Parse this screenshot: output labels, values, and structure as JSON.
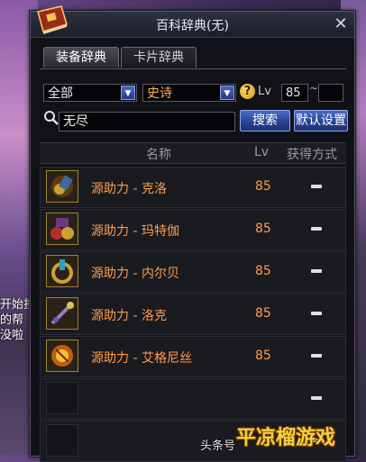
{
  "window": {
    "title": "百科辞典(无)",
    "close_label": "✕"
  },
  "tabs": [
    {
      "label": "装备辞典",
      "active": true
    },
    {
      "label": "卡片辞典",
      "active": false
    }
  ],
  "filters": {
    "category_value": "全部",
    "rarity_value": "史诗",
    "help_label": "?",
    "lv_label": "Lv",
    "lv_min": "85",
    "lv_separator": "~",
    "lv_max": ""
  },
  "search": {
    "value": "无尽",
    "search_button": "搜索",
    "reset_button": "默认设置"
  },
  "table": {
    "headers": {
      "name": "名称",
      "lv": "Lv",
      "source": "获得方式"
    },
    "rows": [
      {
        "name": "源助力 - 克洛",
        "lv": "85",
        "icon": "equipment-icon"
      },
      {
        "name": "源助力 - 玛特伽",
        "lv": "85",
        "icon": "equipment-icon"
      },
      {
        "name": "源助力 - 内尔贝",
        "lv": "85",
        "icon": "equipment-icon"
      },
      {
        "name": "源助力 - 洛克",
        "lv": "85",
        "icon": "equipment-icon"
      },
      {
        "name": "源助力 - 艾格尼丝",
        "lv": "85",
        "icon": "equipment-icon"
      },
      {
        "name": "",
        "lv": "",
        "icon": ""
      },
      {
        "name": "",
        "lv": "",
        "icon": ""
      }
    ]
  },
  "background": {
    "left_text": "开始担\n的帮\n没啦",
    "right_text": "能\n道"
  },
  "watermark": {
    "source": "头条号",
    "brand": "平凉榴游戏"
  },
  "colors": {
    "item_text": "#ff9c4a",
    "dialog_bg": "#111217",
    "button_blue": "#2b4494"
  }
}
